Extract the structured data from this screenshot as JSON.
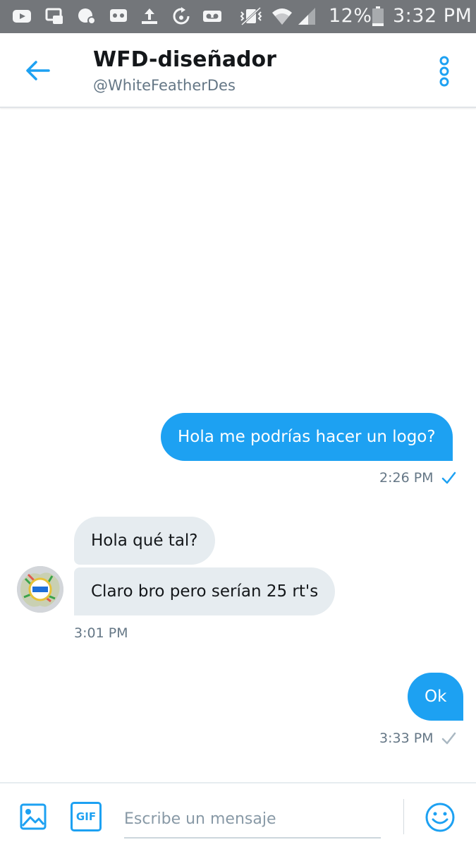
{
  "status_bar": {
    "battery": "12%",
    "time": "3:32 PM",
    "icons": [
      "youtube-icon",
      "cast-icon",
      "game-icon",
      "media-icon",
      "upload-icon",
      "sync-icon",
      "voicemail-icon",
      "vibrate-icon",
      "wifi-icon",
      "signal-icon",
      "battery-icon"
    ]
  },
  "header": {
    "name": "WFD-diseñador",
    "handle": "@WhiteFeatherDes"
  },
  "messages": [
    {
      "side": "sent",
      "text": "Hola me podrías hacer un logo?",
      "time": "2:26 PM",
      "status": "delivered"
    },
    {
      "side": "received",
      "text": "Hola qué tal?"
    },
    {
      "side": "received",
      "text": "Claro bro pero serían 25 rt's",
      "time": "3:01 PM"
    },
    {
      "side": "sent",
      "text": "Ok",
      "time": "3:33 PM",
      "status": "sent"
    }
  ],
  "composer": {
    "placeholder": "Escribe un mensaje",
    "gif_label": "GIF"
  },
  "colors": {
    "accent": "#1da1f2",
    "received_bubble": "#e6ecf0",
    "status_bar": "#73767a"
  }
}
